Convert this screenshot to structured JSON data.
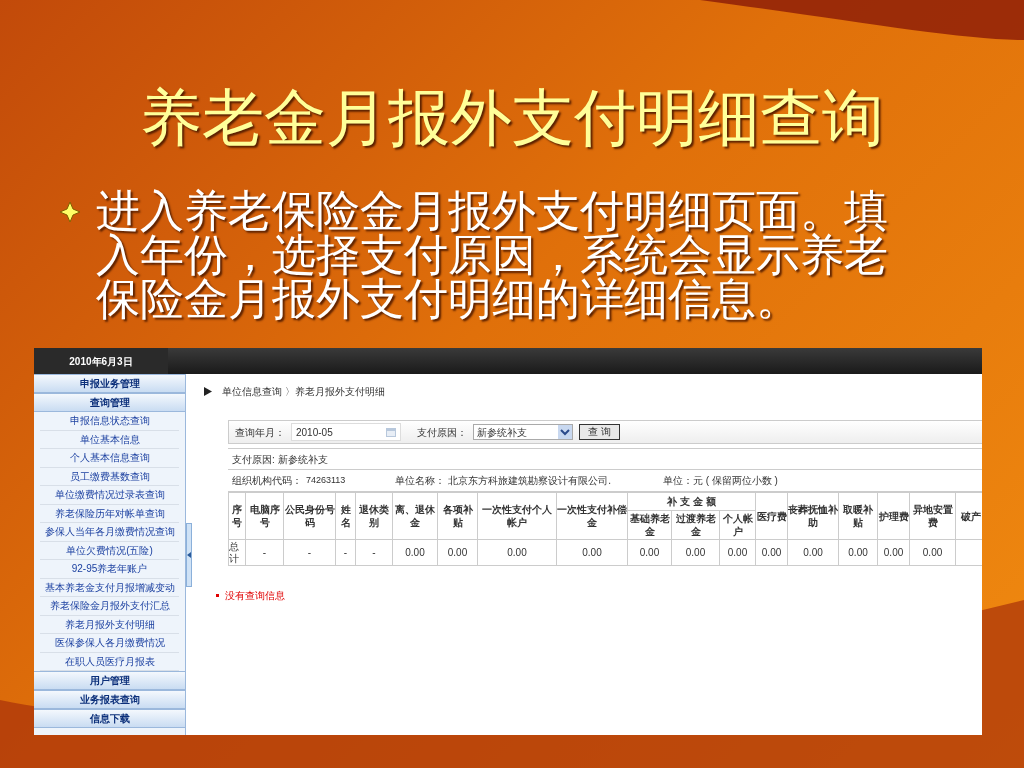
{
  "slide": {
    "title": "养老金月报外支付明细查询",
    "bullets": [
      "进入养老保险金月报外支付明细页面。填入年份，选择支付原因，系统会显示养老保险金月报外支付明细的详细信息。"
    ]
  },
  "screen": {
    "date": "2010年6月3日",
    "sidebar": [
      {
        "label": "申报业务管理"
      },
      {
        "label": "查询管理",
        "children": [
          {
            "label": "申报信息状态查询"
          },
          {
            "label": "单位基本信息"
          },
          {
            "label": "个人基本信息查询"
          },
          {
            "label": "员工缴费基数查询"
          },
          {
            "label": "单位缴费情况过录表查询"
          },
          {
            "label": "养老保险历年对帐单查询"
          },
          {
            "label": "参保人当年各月缴费情况查询"
          },
          {
            "label": "单位欠费情况(五险)"
          },
          {
            "label": "92-95养老年账户"
          },
          {
            "label": "基本养老金支付月报增减变动"
          },
          {
            "label": "养老保险金月报外支付汇总"
          },
          {
            "label": "养老月报外支付明细"
          },
          {
            "label": "医保参保人各月缴费情况"
          },
          {
            "label": "在职人员医疗月报表"
          }
        ]
      },
      {
        "label": "用户管理"
      },
      {
        "label": "业务报表查询"
      },
      {
        "label": "信息下载"
      }
    ],
    "breadcrumb": "单位信息查询 〉养老月报外支付明细",
    "form": {
      "month_label": "查询年月：",
      "month_value": "2010-05",
      "reason_label": "支付原因：",
      "reason_value": "新参统补支",
      "button": "查 询"
    },
    "info": {
      "reason": "支付原因: 新参统补支",
      "org_code_label": "组织机构代码：",
      "org_code": "74263113",
      "unit_name": "单位名称： 北京东方科旅建筑勘察设计有限公司.",
      "unit": "单位：元 ( 保留两位小数 )"
    },
    "table": {
      "columns": [
        {
          "label": "序号"
        },
        {
          "label": "电脑序号"
        },
        {
          "label": "公民身份号码"
        },
        {
          "label": "姓名"
        },
        {
          "label": "退休类别"
        },
        {
          "label": "离、退休金"
        },
        {
          "label": "各项补贴"
        },
        {
          "label": "一次性支付个人帐户"
        },
        {
          "label": "一次性支付补偿金"
        },
        {
          "label": "补 支 金 额",
          "children": [
            {
              "label": "基础养老金"
            },
            {
              "label": "过渡养老金"
            },
            {
              "label": "个人帐户"
            }
          ]
        },
        {
          "label": "医疗费"
        },
        {
          "label": "丧葬抚恤补助"
        },
        {
          "label": "取暖补贴"
        },
        {
          "label": "护理费"
        },
        {
          "label": "异地安置费"
        },
        {
          "label": "破产"
        }
      ],
      "total_row": [
        "总计",
        "-",
        "-",
        "-",
        "-",
        "0.00",
        "0.00",
        "0.00",
        "0.00",
        "0.00",
        "0.00",
        "0.00",
        "0.00",
        "0.00",
        "0.00",
        "0.00",
        "0.00"
      ]
    },
    "message": "没有查询信息"
  }
}
